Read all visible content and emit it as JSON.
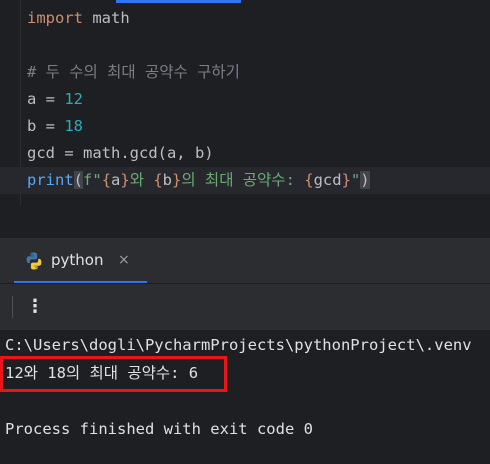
{
  "editor": {
    "lines": [
      {
        "kw": "import",
        "rest": " math"
      },
      {
        "comment": "# 두 수의 최대 공약수 구하기"
      },
      {
        "var": "a = ",
        "num": "12"
      },
      {
        "var": "b = ",
        "num": "18"
      },
      {
        "text": "gcd = math.gcd(a, b)"
      },
      {
        "fn": "print",
        "open": "(",
        "prefix": "f\"",
        "brace_a_open": "{",
        "a": "a",
        "brace_a_close": "}",
        "mid1": "와 ",
        "brace_b_open": "{",
        "b": "b",
        "brace_b_close": "}",
        "mid2": "의 최대 공약수: ",
        "brace_g_open": "{",
        "g": "gcd",
        "brace_g_close": "}",
        "suffix": "\"",
        "close": ")"
      }
    ]
  },
  "run_tab": {
    "label": "python",
    "close_glyph": "×",
    "icon": "python-icon"
  },
  "toolbar": {
    "more_glyph": "⋮"
  },
  "console": {
    "command": "C:\\Users\\dogli\\PycharmProjects\\pythonProject\\.venv",
    "output": "12와 18의 최대 공약수: 6",
    "exit": "Process finished with exit code 0"
  },
  "colors": {
    "highlight_box": "#e8151c",
    "tab_accent": "#3574f0"
  }
}
